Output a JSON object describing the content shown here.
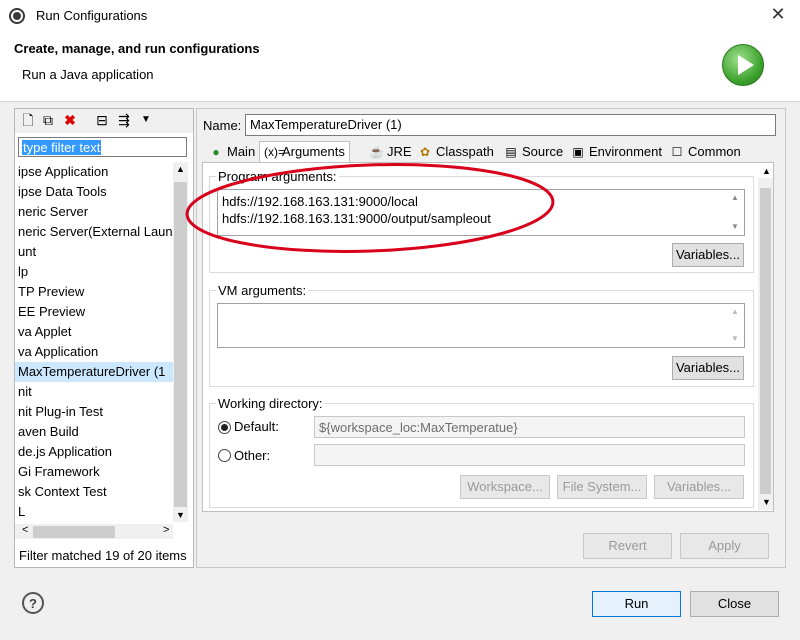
{
  "window": {
    "title": "Run Configurations",
    "close": "✕"
  },
  "banner": {
    "title": "Create, manage, and run configurations",
    "subtitle": "Run a Java application"
  },
  "left": {
    "filter_value": "type filter text",
    "tree_items": [
      "ipse Application",
      "ipse Data Tools",
      "neric Server",
      "neric Server(External Launc",
      "unt",
      "lp",
      "TP Preview",
      "EE Preview",
      "va Applet",
      "va Application",
      "MaxTemperatureDriver (1",
      "nit",
      "nit Plug-in Test",
      "aven Build",
      "de.js Application",
      "Gi Framework",
      "sk Context Test",
      "L"
    ],
    "selected_index": 10,
    "status": "Filter matched 19 of 20 items"
  },
  "right": {
    "name_label": "Name:",
    "name_value": "MaxTemperatureDriver (1)",
    "tabs": [
      {
        "label": "Main",
        "icon": "main-icon"
      },
      {
        "label": "Arguments",
        "icon": "arguments-icon"
      },
      {
        "label": "JRE",
        "icon": "jre-icon"
      },
      {
        "label": "Classpath",
        "icon": "classpath-icon"
      },
      {
        "label": "Source",
        "icon": "source-icon"
      },
      {
        "label": "Environment",
        "icon": "environment-icon"
      },
      {
        "label": "Common",
        "icon": "common-icon"
      }
    ],
    "active_tab": "Arguments",
    "program_args_label": "Program arguments:",
    "program_args_lines": [
      "hdfs://192.168.163.131:9000/local",
      "hdfs://192.168.163.131:9000/output/sampleout"
    ],
    "variables_label": "Variables...",
    "vm_args_label": "VM arguments:",
    "working_dir_label": "Working directory:",
    "default_label": "Default:",
    "default_value": "${workspace_loc:MaxTemperatue}",
    "other_label": "Other:",
    "workspace_btn": "Workspace...",
    "filesystem_btn": "File System...",
    "revert_btn": "Revert",
    "apply_btn": "Apply"
  },
  "footer": {
    "run_btn": "Run",
    "close_btn": "Close",
    "help": "?"
  },
  "colors": {
    "annotation": "#d9001b",
    "selection": "#cce8ff",
    "run_green": "#3aa02b"
  }
}
